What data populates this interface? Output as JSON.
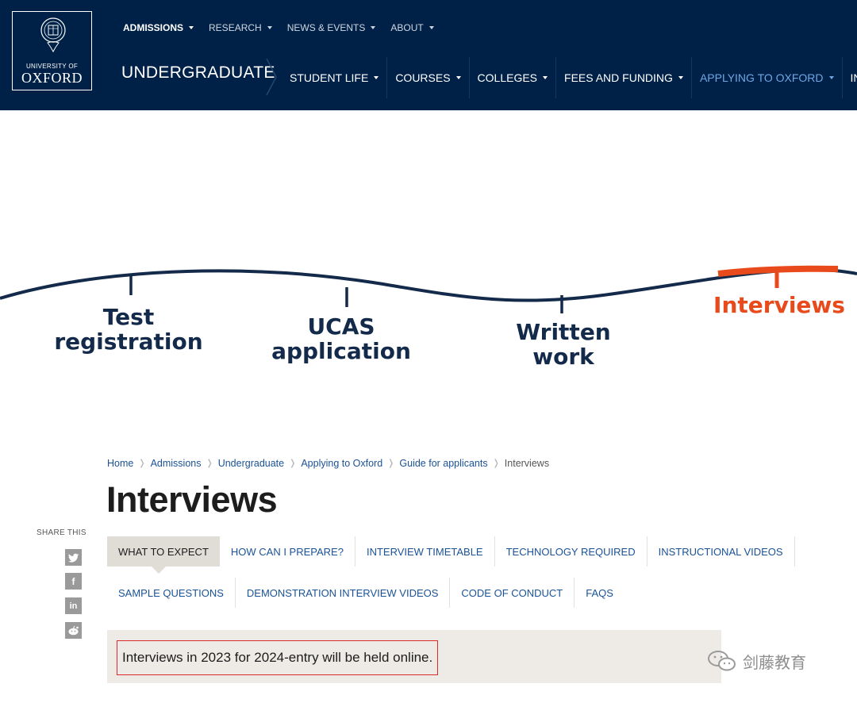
{
  "header": {
    "logo": {
      "line1": "UNIVERSITY OF",
      "line2": "OXFORD"
    },
    "top_nav": [
      "ADMISSIONS",
      "RESEARCH",
      "NEWS & EVENTS",
      "ABOUT"
    ],
    "section_title": "UNDERGRADUATE",
    "main_nav": [
      {
        "label": "STUDENT LIFE",
        "active": false
      },
      {
        "label": "COURSES",
        "active": false
      },
      {
        "label": "COLLEGES",
        "active": false
      },
      {
        "label": "FEES AND FUNDING",
        "active": false
      },
      {
        "label": "APPLYING TO OXFORD",
        "active": true
      },
      {
        "label": "INCREA",
        "active": false
      }
    ],
    "colors": {
      "background": "#002147",
      "active_link": "#6fa6e6"
    }
  },
  "journey": {
    "stages": [
      {
        "line1": "Test",
        "line2": "registration"
      },
      {
        "line1": "UCAS",
        "line2": "application"
      },
      {
        "line1": "Written",
        "line2": "work"
      },
      {
        "line1": "Interviews",
        "line2": ""
      }
    ],
    "colors": {
      "line": "#132a4a",
      "highlight": "#e84a1c"
    }
  },
  "breadcrumb": [
    "Home",
    "Admissions",
    "Undergraduate",
    "Applying to Oxford",
    "Guide for applicants",
    "Interviews"
  ],
  "page_title": "Interviews",
  "share": {
    "label": "SHARE THIS",
    "icons": [
      "twitter-icon",
      "facebook-icon",
      "linkedin-icon",
      "reddit-icon"
    ]
  },
  "tabs": {
    "row1": [
      "WHAT TO EXPECT",
      "HOW CAN I PREPARE?",
      "INTERVIEW TIMETABLE",
      "TECHNOLOGY REQUIRED",
      "INSTRUCTIONAL VIDEOS"
    ],
    "row2": [
      "SAMPLE QUESTIONS",
      "DEMONSTRATION INTERVIEW VIDEOS",
      "CODE OF CONDUCT",
      "FAQS"
    ],
    "active": "WHAT TO EXPECT"
  },
  "notice": "Interviews in 2023 for 2024-entry will be held online.",
  "watermark": "剑藤教育"
}
